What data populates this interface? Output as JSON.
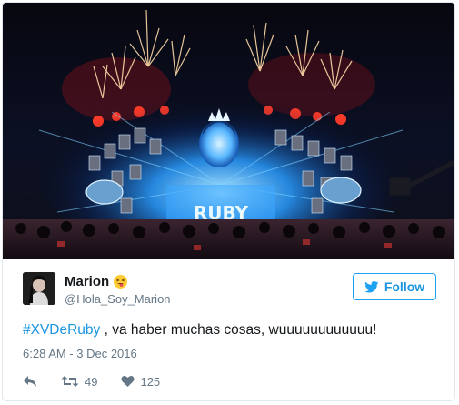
{
  "tweet": {
    "author": {
      "display_name": "Marion",
      "handle": "@Hola_Soy_Marion",
      "emoji_icon": "squinting-tongue-emoji"
    },
    "follow_label": "Follow",
    "hashtag": "#XVDeRuby",
    "body": " , va haber muchas cosas, wuuuuuuuuuuuu!",
    "timestamp": "6:28 AM - 3 Dec 2016",
    "retweet_count": "49",
    "like_count": "125",
    "photo": {
      "stage_text": "RUBY"
    }
  },
  "colors": {
    "accent": "#1b95e0",
    "text": "#14171a",
    "muted": "#657786",
    "border": "#e1e8ed"
  }
}
